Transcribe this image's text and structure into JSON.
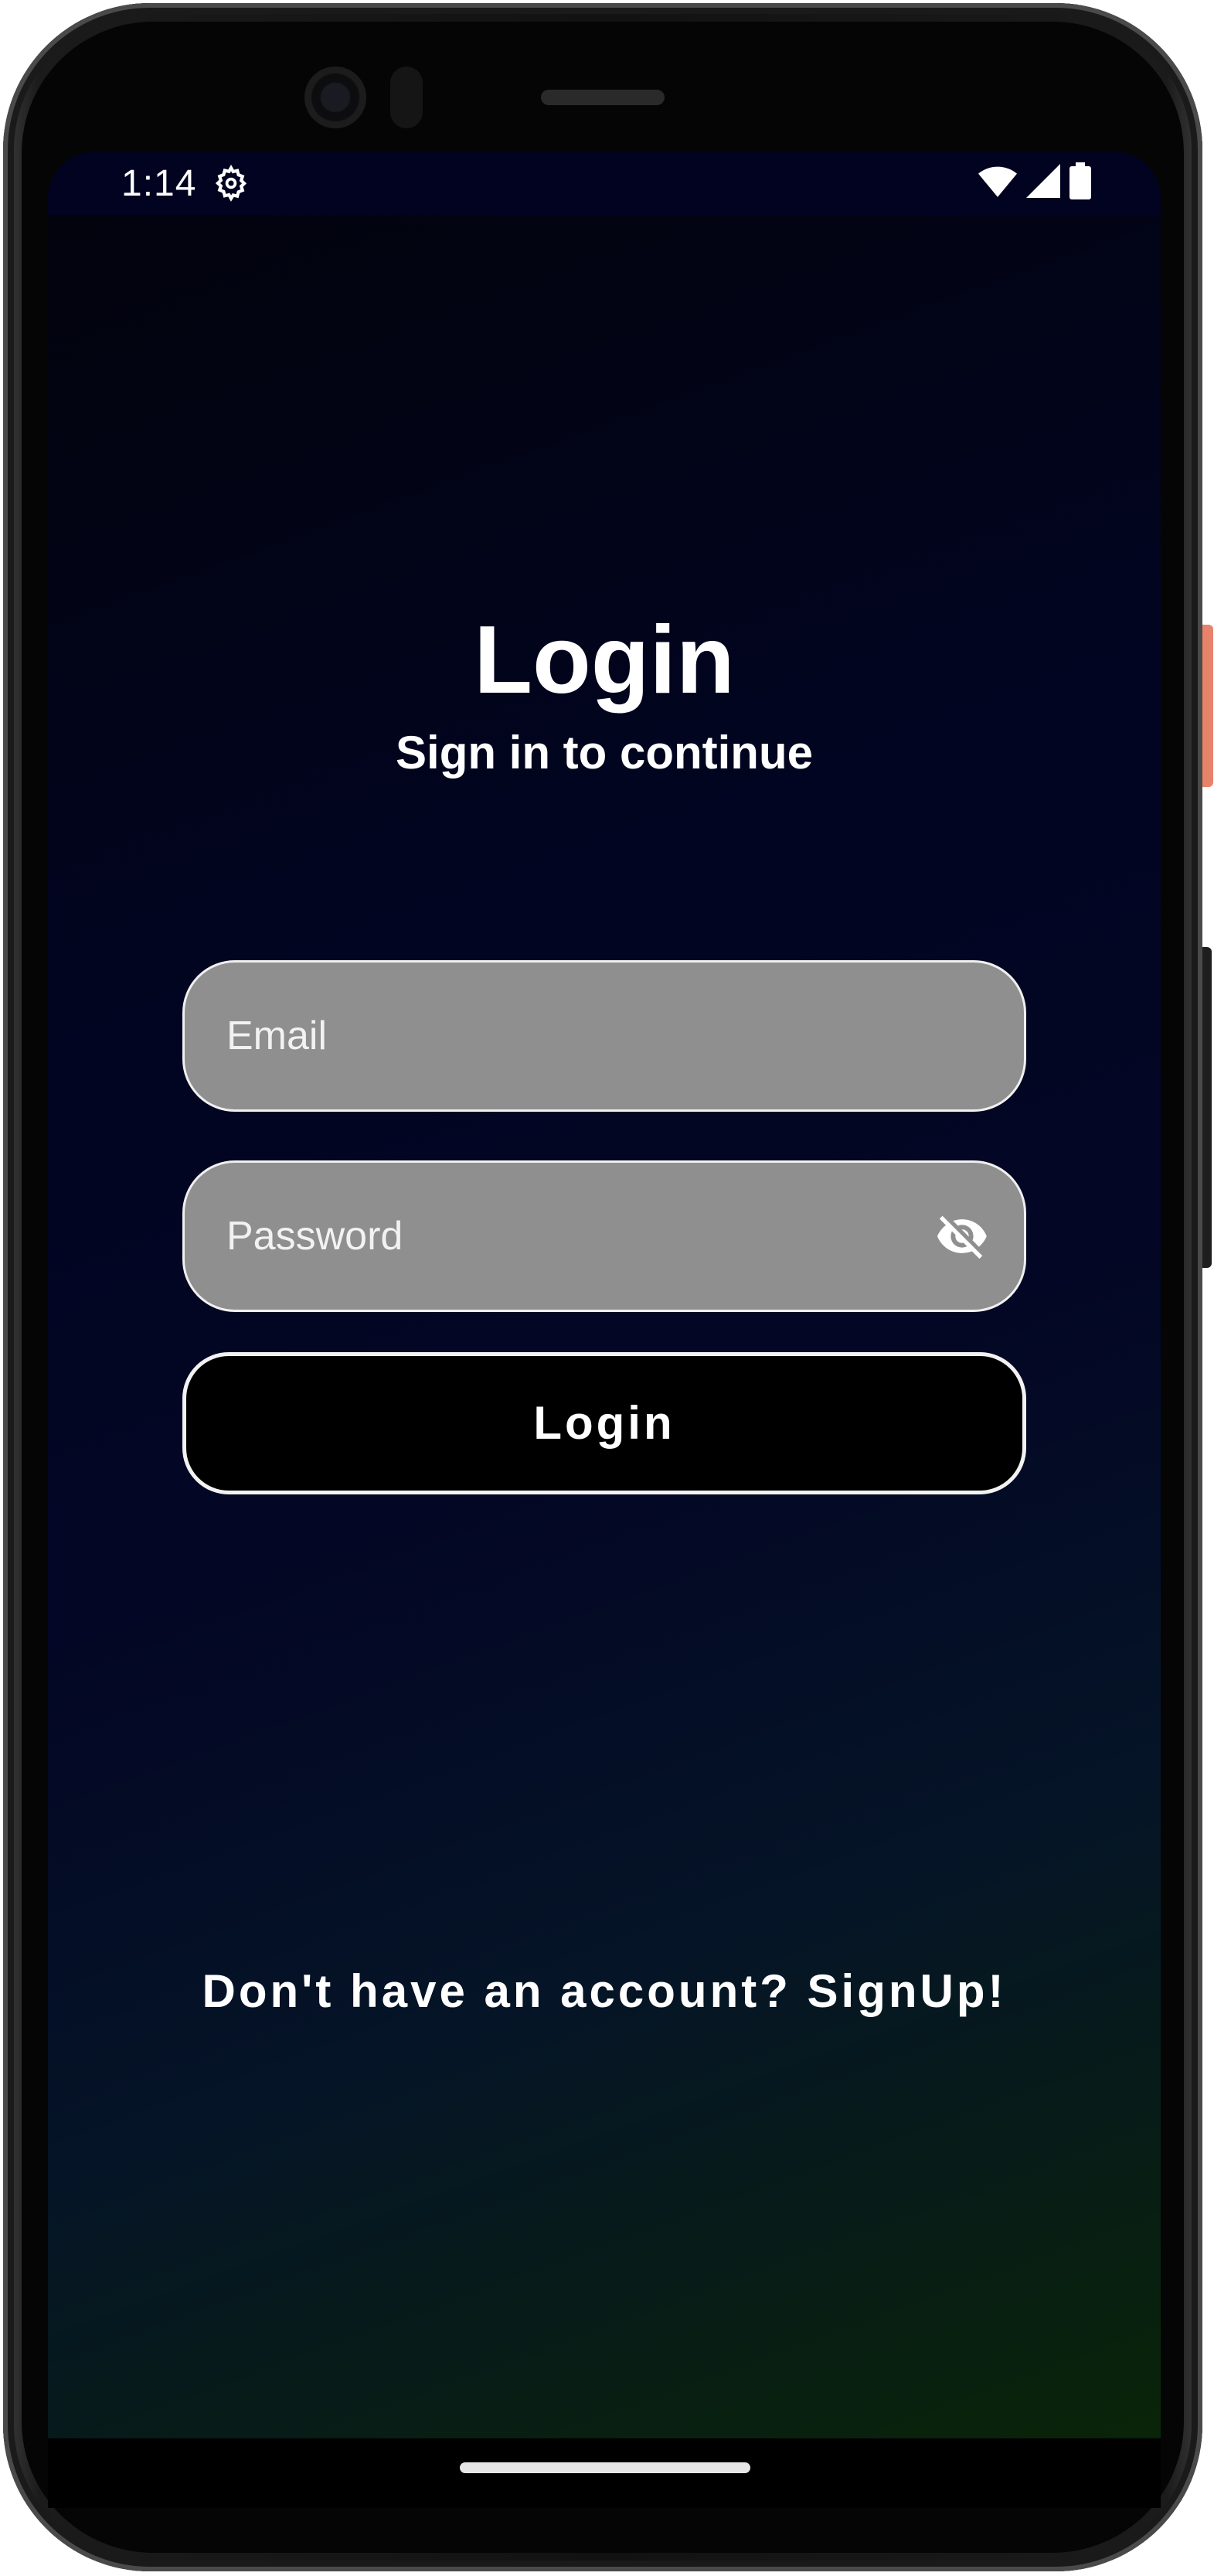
{
  "status_bar": {
    "time": "1:14",
    "settings_icon": "gear-icon",
    "wifi_icon": "wifi-icon",
    "signal_icon": "cell-signal-icon",
    "battery_icon": "battery-icon"
  },
  "login": {
    "title": "Login",
    "subtitle": "Sign in to continue",
    "email_placeholder": "Email",
    "email_value": "",
    "password_placeholder": "Password",
    "password_value": "",
    "password_toggle_icon": "eye-off-icon",
    "login_button_label": "Login",
    "signup_prompt": "Don't have an account? SignUp!"
  },
  "colors": {
    "background_top": "#02030b",
    "background_mid": "#020522",
    "background_bottom": "#092408",
    "field_fill": "#8f8f8f",
    "field_border": "#f0f0f0",
    "button_fill": "#000000",
    "text": "#ffffff"
  }
}
